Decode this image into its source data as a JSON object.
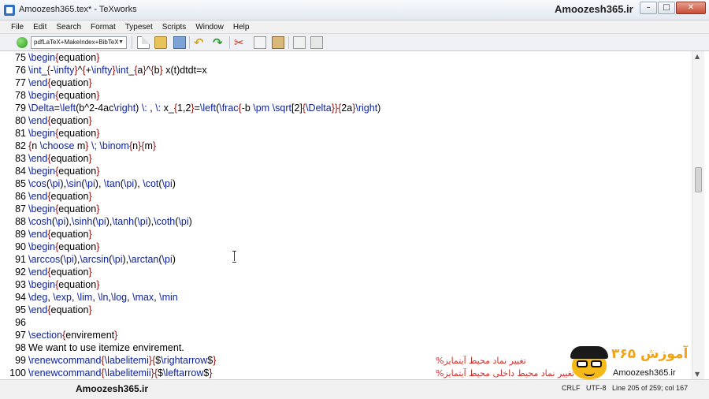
{
  "window": {
    "title": "Amoozesh365.tex* - TeXworks",
    "watermark_top": "Amoozesh365.ir",
    "minimize": "–",
    "maximize": "□",
    "close": "✕"
  },
  "menu": [
    "File",
    "Edit",
    "Search",
    "Format",
    "Typeset",
    "Scripts",
    "Window",
    "Help"
  ],
  "toolbar": {
    "typeset_icon": "play-icon",
    "engine": "pdfLaTeX+MakeIndex+BibTeX",
    "icons": [
      "new-document-icon",
      "open-folder-icon",
      "save-icon",
      "undo-icon",
      "redo-icon",
      "cut-icon",
      "copy-icon",
      "paste-icon",
      "find-icon",
      "replace-icon"
    ]
  },
  "editor": {
    "lines": [
      {
        "n": "75",
        "t": "\\begin{equation}"
      },
      {
        "n": "76",
        "t": "\\int_{-\\infty}^{+\\infty}\\int_{a}^{b} x(t)dtdt=x"
      },
      {
        "n": "77",
        "t": "\\end{equation}"
      },
      {
        "n": "78",
        "t": "\\begin{equation}"
      },
      {
        "n": "79",
        "t": "\\Delta=\\left(b^2-4ac\\right) \\: , \\: x_{1,2}=\\left(\\frac{-b \\pm \\sqrt[2]{\\Delta}}{2a}\\right)"
      },
      {
        "n": "80",
        "t": "\\end{equation}"
      },
      {
        "n": "81",
        "t": "\\begin{equation}"
      },
      {
        "n": "82",
        "t": "{n \\choose m} \\; \\binom{n}{m}"
      },
      {
        "n": "83",
        "t": "\\end{equation}"
      },
      {
        "n": "84",
        "t": "\\begin{equation}"
      },
      {
        "n": "85",
        "t": "\\cos(\\pi),\\sin(\\pi), \\tan(\\pi), \\cot(\\pi)"
      },
      {
        "n": "86",
        "t": "\\end{equation}"
      },
      {
        "n": "87",
        "t": "\\begin{equation}"
      },
      {
        "n": "88",
        "t": "\\cosh(\\pi),\\sinh(\\pi),\\tanh(\\pi),\\coth(\\pi)"
      },
      {
        "n": "89",
        "t": "\\end{equation}"
      },
      {
        "n": "90",
        "t": "\\begin{equation}"
      },
      {
        "n": "91",
        "t": "\\arccos(\\pi),\\arcsin(\\pi),\\arctan(\\pi)"
      },
      {
        "n": "92",
        "t": "\\end{equation}"
      },
      {
        "n": "93",
        "t": "\\begin{equation}"
      },
      {
        "n": "94",
        "t": "\\deg, \\exp, \\lim, \\ln,\\log, \\max, \\min"
      },
      {
        "n": "95",
        "t": "\\end{equation}"
      },
      {
        "n": "96",
        "t": ""
      },
      {
        "n": "97",
        "t": "\\section{envirement}"
      },
      {
        "n": "98",
        "t": "We want to use itemize envirement."
      },
      {
        "n": "99",
        "t": "\\renewcommand{\\labelitemi}{$\\rightarrow$}"
      },
      {
        "n": "100",
        "t": "\\renewcommand{\\labelitemii}{$\\leftarrow$}"
      }
    ],
    "comment_99": "تغییر نماد محیط آیتمایز%",
    "comment_100": "تغییر نماد محیط داخلی محیط آیتمایز%"
  },
  "logo": {
    "text_fa": "آموزش ۳۶۵",
    "domain": "Amoozesh365.ir"
  },
  "status": {
    "watermark_bottom": "Amoozesh365.ir",
    "line_ending": "CRLF",
    "encoding": "UTF-8",
    "position": "Line 205 of 259; col 167"
  }
}
